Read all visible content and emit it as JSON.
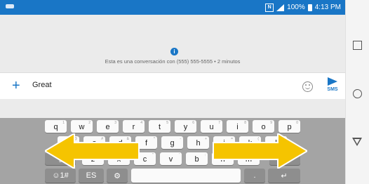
{
  "status_bar": {
    "battery": "100%",
    "time": "4:13 PM"
  },
  "conversation": {
    "info_text": "Esta es una conversación con (555) 555-5555 • 2 minutos"
  },
  "compose": {
    "text": "Great",
    "send_label": "SMS"
  },
  "keyboard": {
    "row1": [
      {
        "k": "q",
        "h": "1"
      },
      {
        "k": "w",
        "h": "2"
      },
      {
        "k": "e",
        "h": "3"
      },
      {
        "k": "r",
        "h": "4"
      },
      {
        "k": "t",
        "h": "5"
      },
      {
        "k": "y",
        "h": "6"
      },
      {
        "k": "u",
        "h": "7"
      },
      {
        "k": "i",
        "h": "8"
      },
      {
        "k": "o",
        "h": "9"
      },
      {
        "k": "p",
        "h": "0"
      }
    ],
    "row2": [
      {
        "k": "a",
        "h": "@"
      },
      {
        "k": "s",
        "h": "#"
      },
      {
        "k": "d",
        "h": "&"
      },
      {
        "k": "f",
        "h": "*"
      },
      {
        "k": "g",
        "h": "-"
      },
      {
        "k": "h",
        "h": "+"
      },
      {
        "k": "j",
        "h": "="
      },
      {
        "k": "k",
        "h": "("
      },
      {
        "k": "l",
        "h": ")"
      }
    ],
    "row3": [
      {
        "k": "z",
        "h": "_"
      },
      {
        "k": "x",
        "h": "$"
      },
      {
        "k": "c",
        "h": "\""
      },
      {
        "k": "v",
        "h": "'"
      },
      {
        "k": "b",
        "h": ":"
      },
      {
        "k": "n",
        "h": ";"
      },
      {
        "k": "m",
        "h": "/"
      }
    ],
    "symbols_key": "☺1#",
    "lang_key": "ES",
    "comma_key": ",",
    "period_key": "."
  },
  "colors": {
    "accent": "#1976c6",
    "arrow": "#f5c400"
  },
  "icons": [
    "nfc-icon",
    "signal-icon",
    "battery-icon",
    "info-icon",
    "plus-icon",
    "emoji-icon",
    "send-icon",
    "shift-icon",
    "backspace-icon",
    "gear-icon",
    "enter-icon",
    "nav-recent-icon",
    "nav-home-icon",
    "nav-back-icon"
  ]
}
